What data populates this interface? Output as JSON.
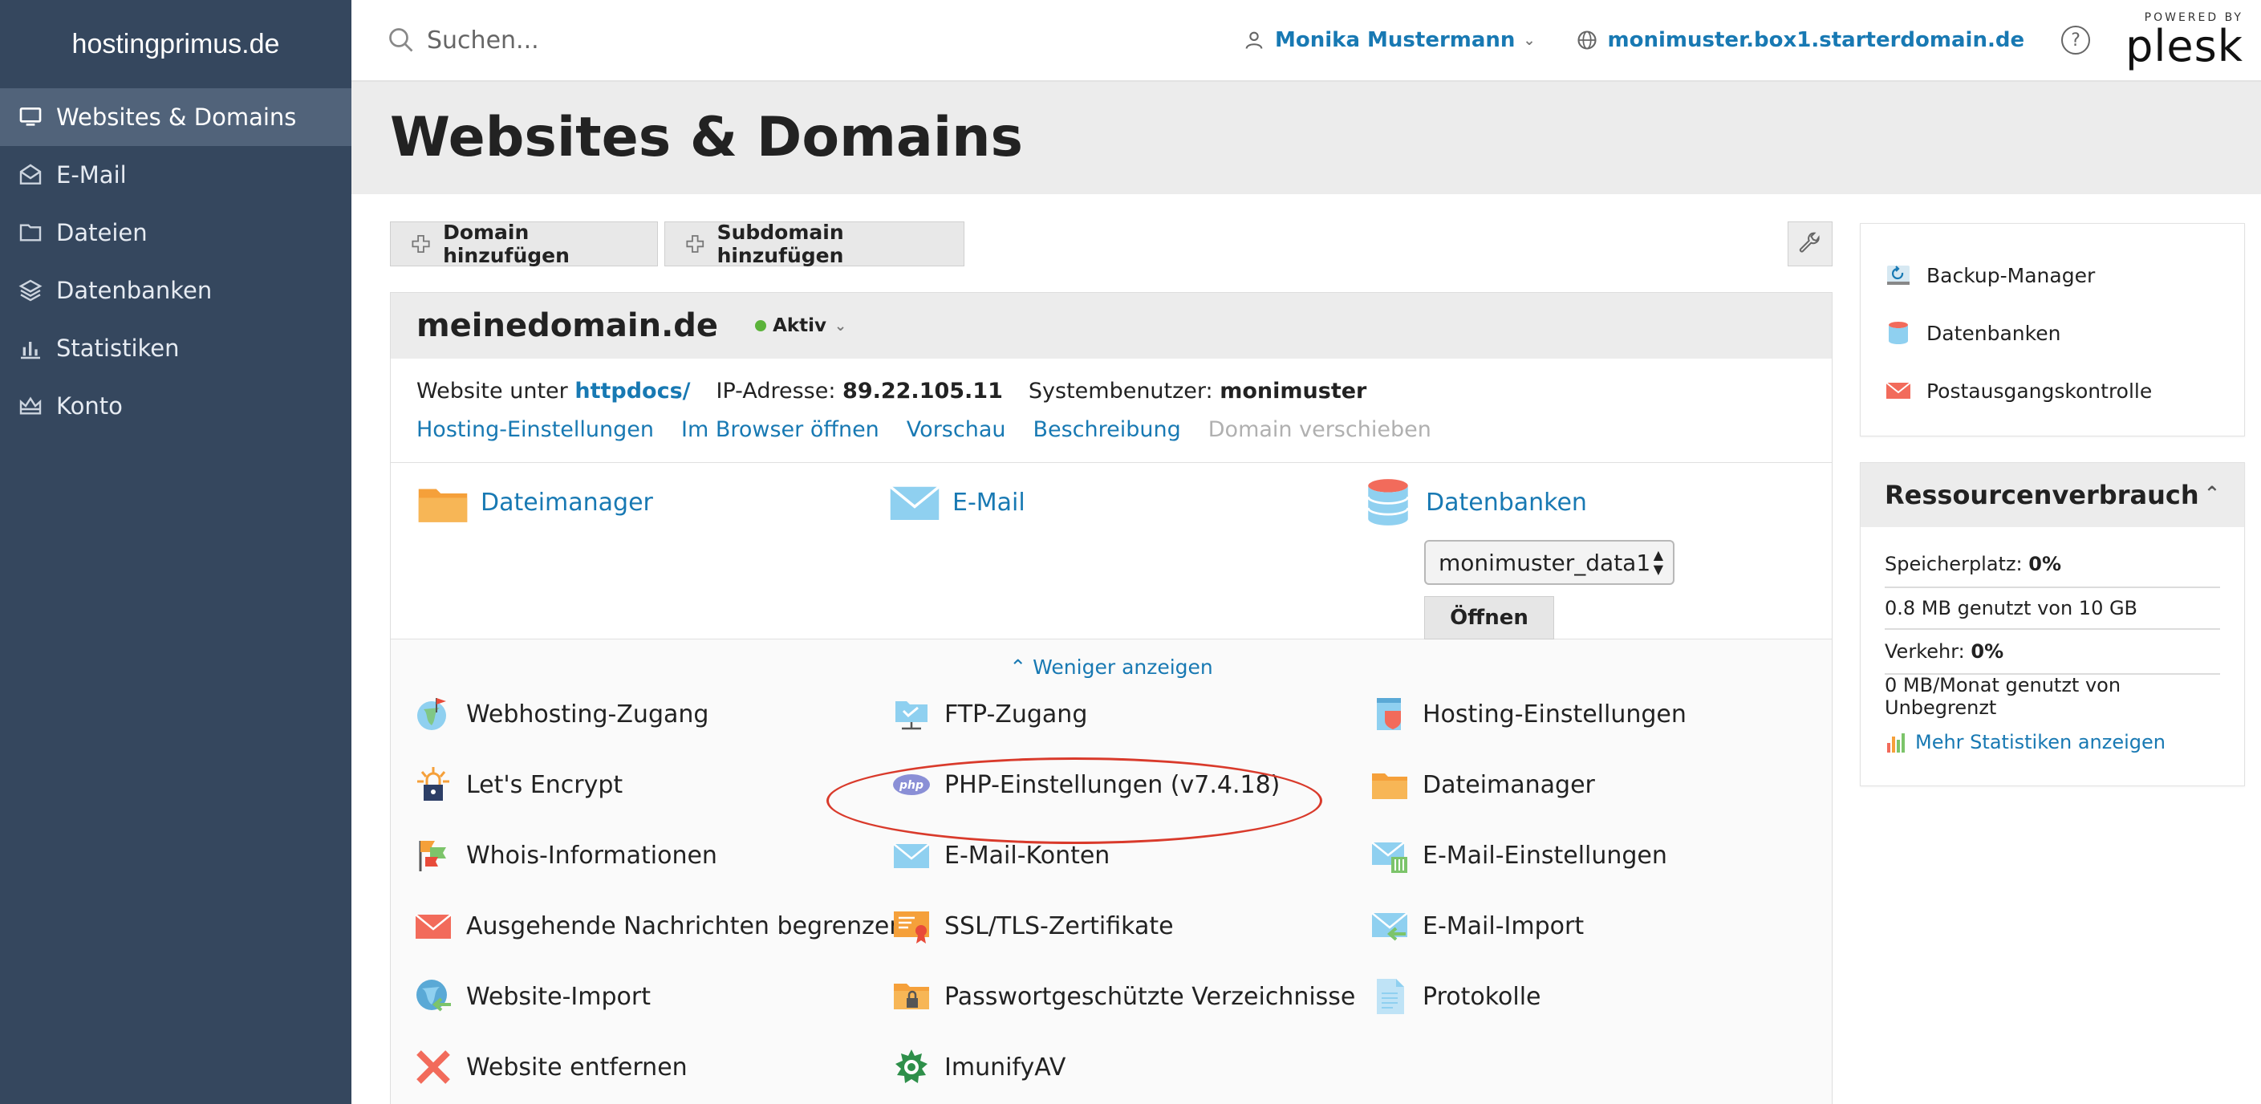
{
  "sidebar": {
    "brand": "hostingprimus.de",
    "items": [
      {
        "label": "Websites & Domains",
        "icon": "monitor-icon",
        "active": true
      },
      {
        "label": "E-Mail",
        "icon": "envelope-icon"
      },
      {
        "label": "Dateien",
        "icon": "folder-icon"
      },
      {
        "label": "Datenbanken",
        "icon": "layers-icon"
      },
      {
        "label": "Statistiken",
        "icon": "bar-chart-icon"
      },
      {
        "label": "Konto",
        "icon": "crown-icon"
      }
    ]
  },
  "topbar": {
    "search_placeholder": "Suchen...",
    "user_name": "Monika Mustermann",
    "domain": "monimuster.box1.starterdomain.de",
    "help": "?",
    "powered_by": "POWERED BY",
    "plesk": "plesk"
  },
  "page": {
    "title": "Websites & Domains"
  },
  "toolbar": {
    "add_domain": "Domain hinzufügen",
    "add_subdomain": "Subdomain hinzufügen"
  },
  "domain": {
    "name": "meinedomain.de",
    "status": "Aktiv",
    "status_color": "#5bb33a",
    "website_label": "Website unter",
    "website_path": "httpdocs/",
    "ip_label": "IP-Adresse:",
    "ip": "89.22.105.11",
    "sysuser_label": "Systembenutzer:",
    "sysuser": "monimuster",
    "links": {
      "hosting": "Hosting-Einstellungen",
      "browser": "Im Browser öffnen",
      "preview": "Vorschau",
      "description": "Beschreibung",
      "move": "Domain verschieben"
    },
    "quick": {
      "filemanager": "Dateimanager",
      "email": "E-Mail",
      "databases": "Datenbanken",
      "db_selected": "monimuster_data1",
      "open": "Öffnen"
    },
    "less": "Weniger anzeigen",
    "tools": [
      {
        "label": "Webhosting-Zugang",
        "icon": "globe-flag-icon"
      },
      {
        "label": "FTP-Zugang",
        "icon": "ftp-folder-icon"
      },
      {
        "label": "Hosting-Einstellungen",
        "icon": "hosting-settings-icon"
      },
      {
        "label": "Let's Encrypt",
        "icon": "lets-encrypt-icon"
      },
      {
        "label": "PHP-Einstellungen (v7.4.18)",
        "icon": "php-icon"
      },
      {
        "label": "Dateimanager",
        "icon": "folder-icon"
      },
      {
        "label": "Whois-Informationen",
        "icon": "whois-flags-icon"
      },
      {
        "label": "E-Mail-Konten",
        "icon": "envelope-icon"
      },
      {
        "label": "E-Mail-Einstellungen",
        "icon": "email-settings-icon"
      },
      {
        "label": "Ausgehende Nachrichten begrenzen",
        "icon": "envelope-red-icon"
      },
      {
        "label": "SSL/TLS-Zertifikate",
        "icon": "certificate-icon"
      },
      {
        "label": "E-Mail-Import",
        "icon": "email-import-icon"
      },
      {
        "label": "Website-Import",
        "icon": "website-import-icon"
      },
      {
        "label": "Passwortgeschützte Verzeichnisse",
        "icon": "locked-folder-icon"
      },
      {
        "label": "Protokolle",
        "icon": "log-file-icon"
      },
      {
        "label": "Website entfernen",
        "icon": "remove-x-icon"
      },
      {
        "label": "ImunifyAV",
        "icon": "imunify-icon"
      }
    ]
  },
  "right": {
    "links": [
      {
        "label": "Backup-Manager",
        "icon": "backup-icon"
      },
      {
        "label": "Datenbanken",
        "icon": "database-icon"
      },
      {
        "label": "Postausgangskontrolle",
        "icon": "outgoing-mail-icon"
      }
    ],
    "resources": {
      "title": "Ressourcenverbrauch",
      "storage_label": "Speicherplatz:",
      "storage_value": "0%",
      "storage_used": "0.8 MB genutzt von 10 GB",
      "traffic_label": "Verkehr:",
      "traffic_value": "0%",
      "traffic_used": "0 MB/Monat genutzt von Unbegrenzt",
      "more_stats": "Mehr Statistiken anzeigen"
    }
  },
  "colors": {
    "sidebar": "#35475e",
    "sidebar_active": "#51637a",
    "link": "#1879b3",
    "highlight": "#d93a2b"
  }
}
